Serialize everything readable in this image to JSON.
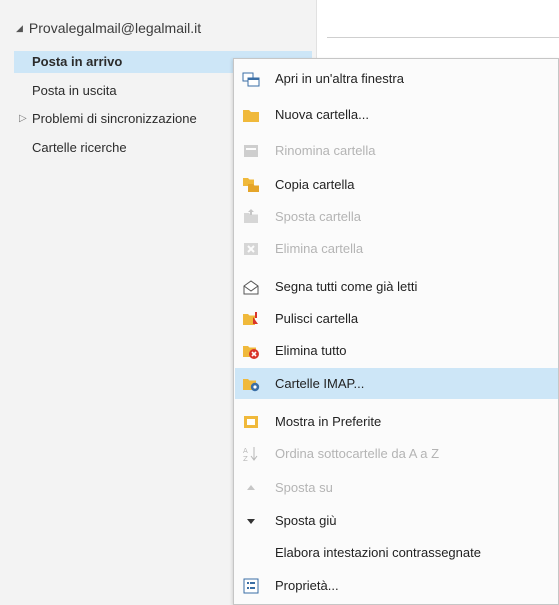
{
  "account": {
    "expand_glyph": "◢",
    "name": "Provalegalmail@legalmail.it"
  },
  "folders": [
    {
      "label": "Posta in arrivo",
      "selected": true
    },
    {
      "label": "Posta in uscita"
    },
    {
      "label": "Problemi di sincronizzazione",
      "expand_glyph": "▷"
    },
    {
      "label": "Cartelle ricerche"
    }
  ],
  "context_menu": {
    "items": [
      {
        "label": "Apri in un'altra finestra",
        "icon": "open-window-icon",
        "enabled": true
      },
      {
        "label": "Nuova cartella...",
        "icon": "new-folder-icon",
        "enabled": true
      },
      {
        "label": "Rinomina cartella",
        "icon": "rename-folder-icon",
        "enabled": false
      },
      {
        "label": "Copia cartella",
        "icon": "copy-folder-icon",
        "enabled": true
      },
      {
        "label": "Sposta cartella",
        "icon": "move-folder-icon",
        "enabled": false
      },
      {
        "label": "Elimina cartella",
        "icon": "delete-folder-icon",
        "enabled": false
      },
      {
        "label": "Segna tutti come già letti",
        "icon": "mark-read-icon",
        "enabled": true
      },
      {
        "label": "Pulisci cartella",
        "icon": "clean-folder-icon",
        "enabled": true
      },
      {
        "label": "Elimina tutto",
        "icon": "delete-all-icon",
        "enabled": true
      },
      {
        "label": "Cartelle IMAP...",
        "icon": "imap-folders-icon",
        "enabled": true,
        "highlighted": true
      },
      {
        "label": "Mostra in Preferite",
        "icon": "show-favorites-icon",
        "enabled": true
      },
      {
        "label": "Ordina sottocartelle da A a Z",
        "icon": "sort-az-icon",
        "enabled": false
      },
      {
        "label": "Sposta su",
        "icon": "move-up-icon",
        "enabled": false
      },
      {
        "label": "Sposta giù",
        "icon": "move-down-icon",
        "enabled": true
      },
      {
        "label": "Elabora intestazioni contrassegnate",
        "icon": "",
        "enabled": true
      },
      {
        "label": "Proprietà...",
        "icon": "properties-icon",
        "enabled": true
      }
    ]
  },
  "colors": {
    "selection": "#cde6f7",
    "folder_yellow": "#f0b93b",
    "red": "#d9342b",
    "pane_background": "#f3f3f3"
  }
}
